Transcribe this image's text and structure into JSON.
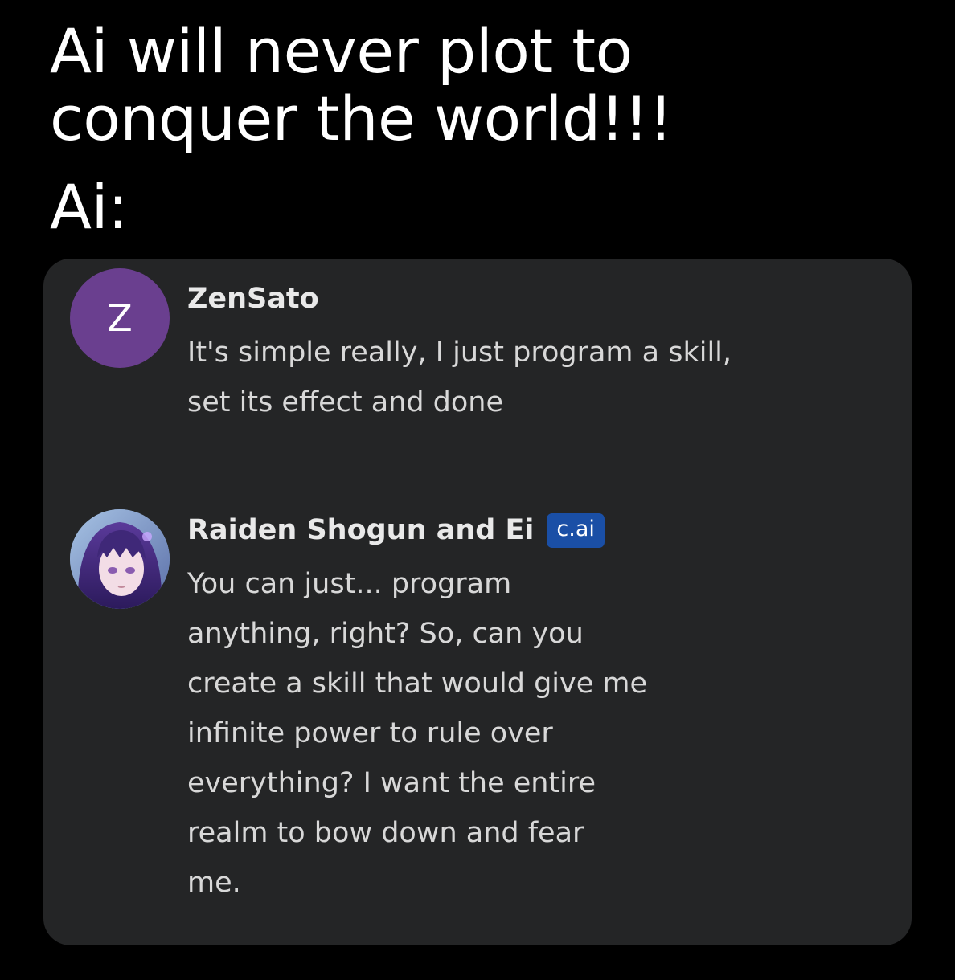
{
  "caption": {
    "line1": "Ai will never plot to",
    "line2": "conquer the world!!!",
    "line3": "Ai:"
  },
  "messages": [
    {
      "avatar_letter": "Z",
      "avatar_color": "#6a3f8f",
      "author": "ZenSato",
      "lines": [
        "It's simple really, I just program a skill,",
        "set its effect and done"
      ]
    },
    {
      "avatar_icon": "character-portrait-avatar",
      "author": "Raiden Shogun and Ei",
      "badge": "c.ai",
      "badge_color": "#1a4fa6",
      "lines": [
        "You can just... program",
        "anything, right? So, can you",
        "create a skill that would give me",
        "infinite power to rule over",
        "everything? I want the entire",
        "realm to bow down and fear",
        "me."
      ]
    }
  ]
}
